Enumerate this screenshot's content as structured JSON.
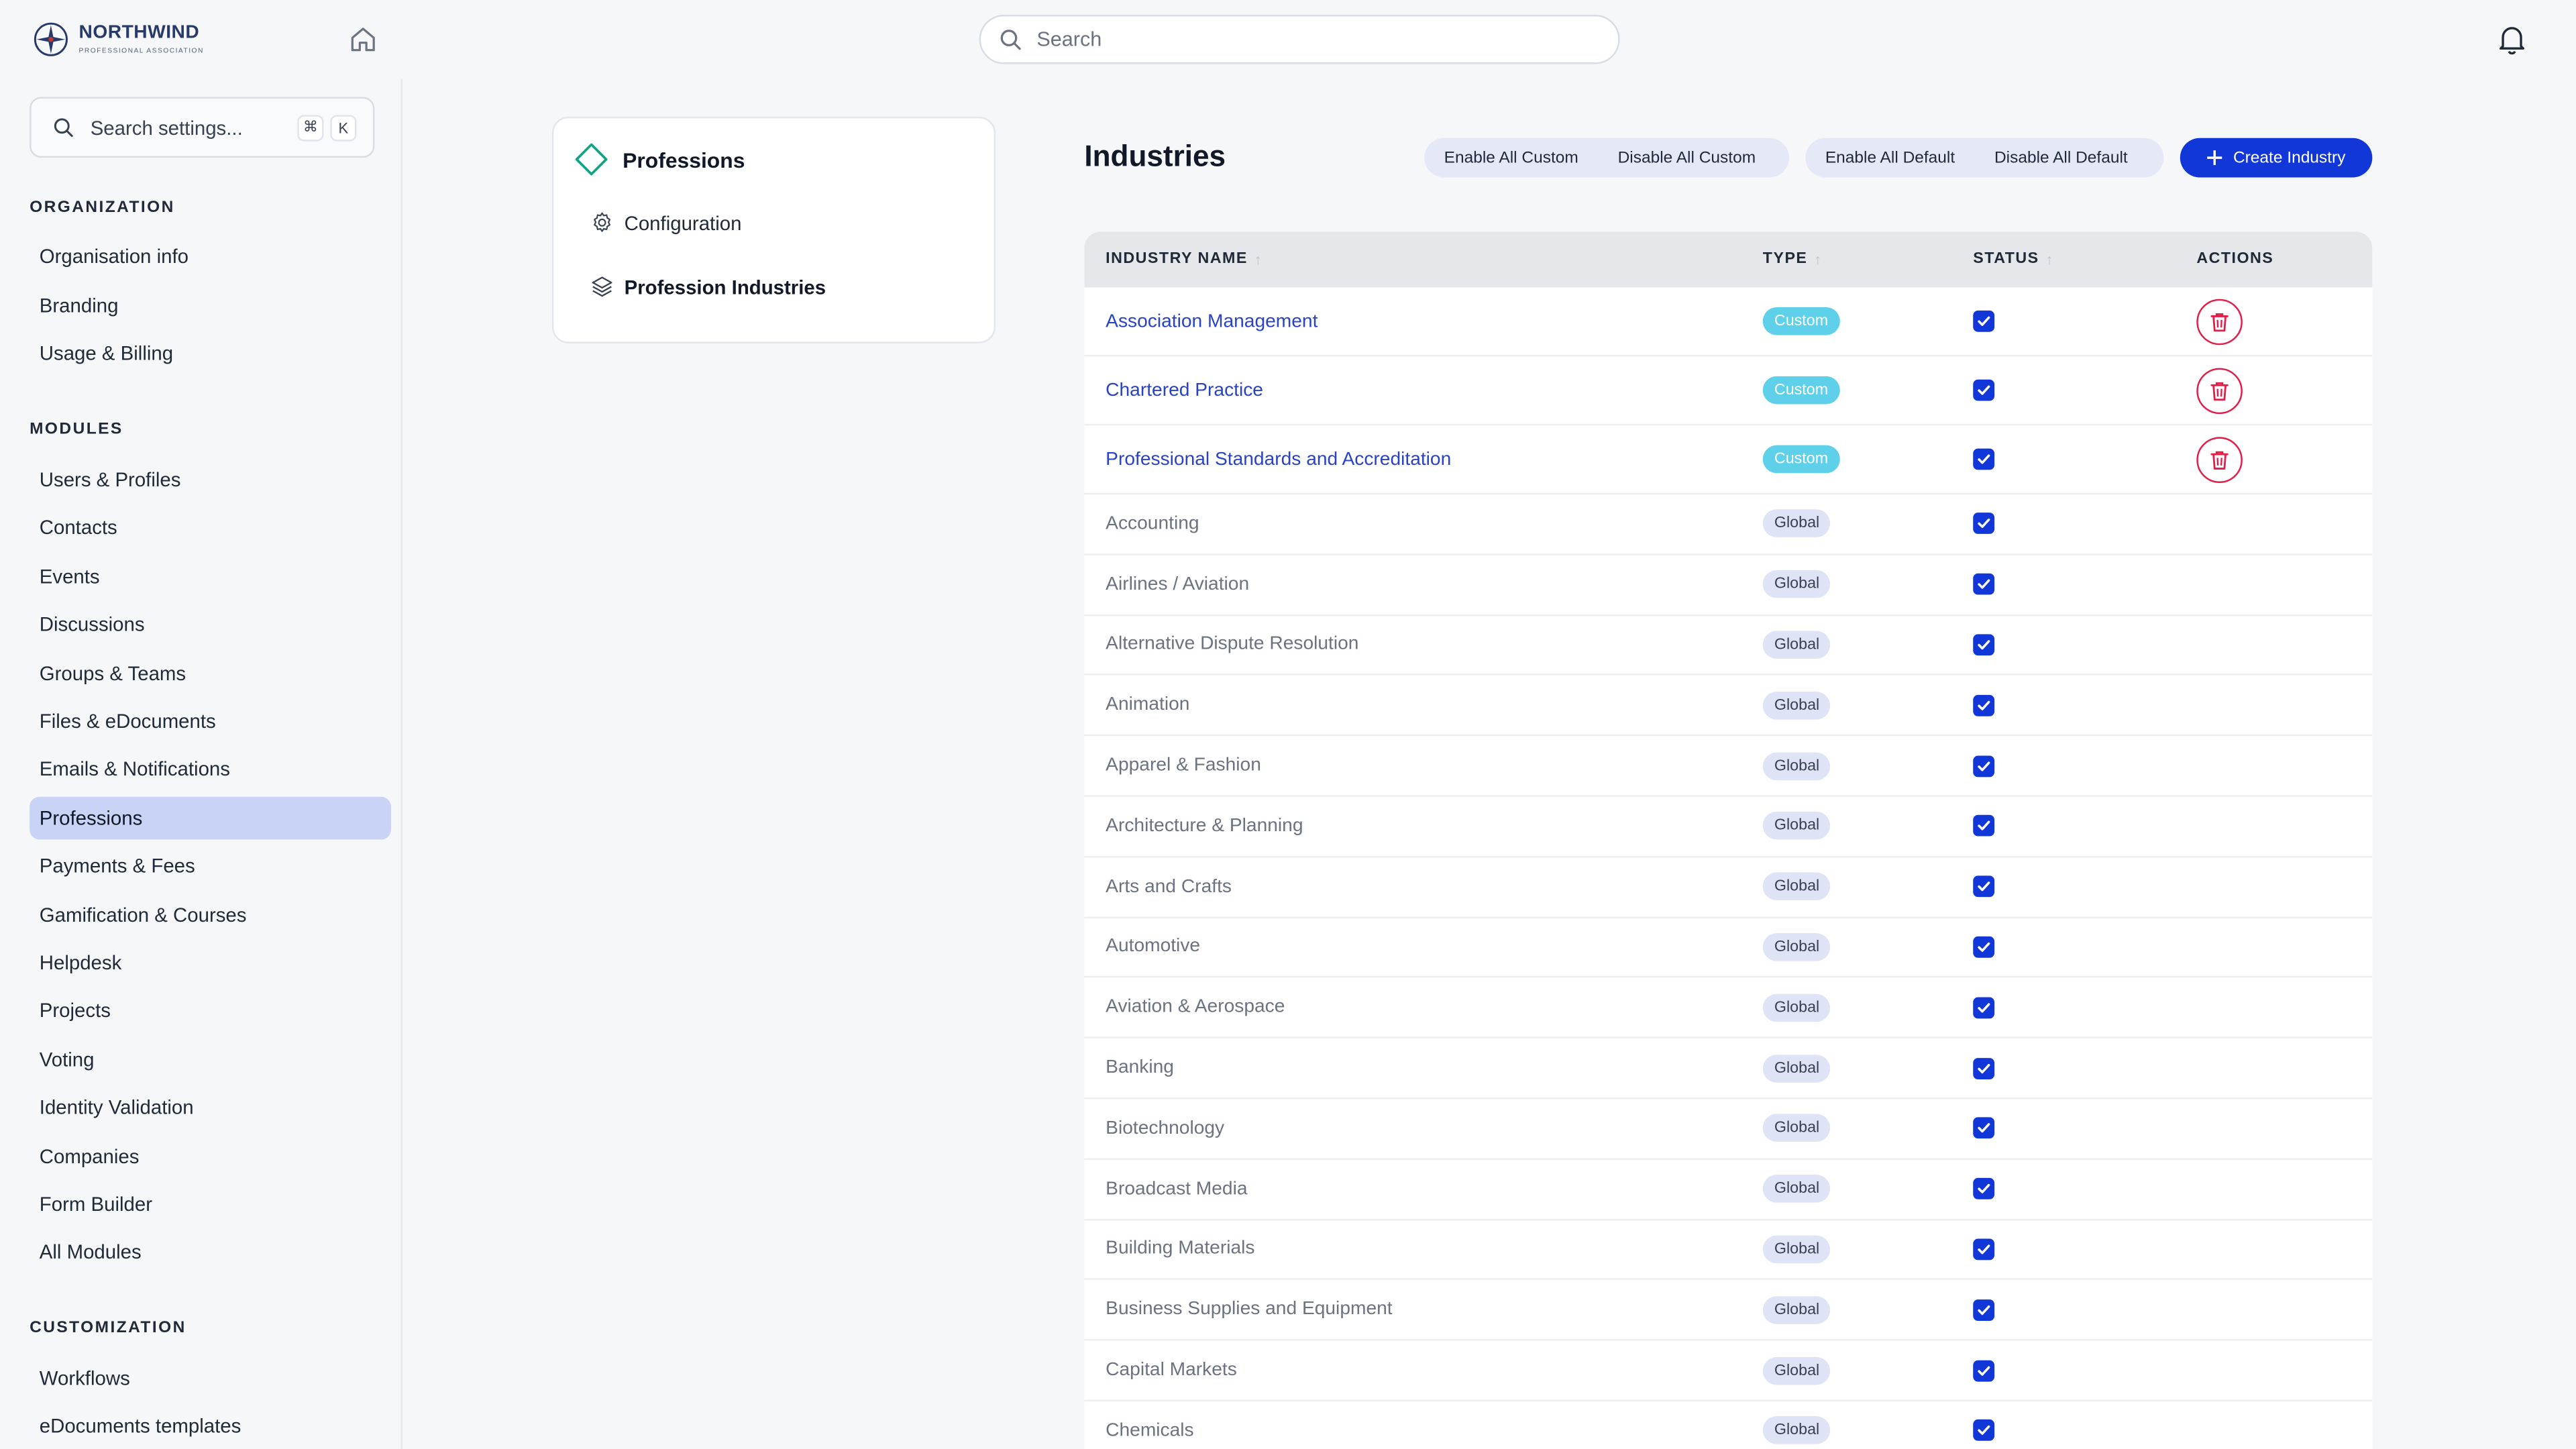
{
  "brand": {
    "name": "NORTHWIND",
    "subtitle": "PROFESSIONAL ASSOCIATION"
  },
  "topbar": {
    "search_placeholder": "Search"
  },
  "sidebar": {
    "search_placeholder": "Search settings...",
    "shortcut_keys": [
      "⌘",
      "K"
    ],
    "sections": [
      {
        "title": "ORGANIZATION",
        "items": [
          "Organisation info",
          "Branding",
          "Usage & Billing"
        ]
      },
      {
        "title": "MODULES",
        "items": [
          "Users & Profiles",
          "Contacts",
          "Events",
          "Discussions",
          "Groups & Teams",
          "Files & eDocuments",
          "Emails & Notifications",
          "Professions",
          "Payments & Fees",
          "Gamification & Courses",
          "Helpdesk",
          "Projects",
          "Voting",
          "Identity Validation",
          "Companies",
          "Form Builder",
          "All Modules"
        ]
      },
      {
        "title": "CUSTOMIZATION",
        "items": [
          "Workflows",
          "eDocuments templates"
        ]
      }
    ],
    "active_item": "Professions"
  },
  "subnav": {
    "title": "Professions",
    "items": [
      {
        "label": "Configuration",
        "icon": "gear-icon",
        "active": false
      },
      {
        "label": "Profession Industries",
        "icon": "layers-icon",
        "active": true
      }
    ]
  },
  "page": {
    "title": "Industries",
    "buttons": {
      "enable_all_custom": "Enable All Custom",
      "disable_all_custom": "Disable All Custom",
      "enable_all_default": "Enable All Default",
      "disable_all_default": "Disable All Default",
      "create": "Create Industry"
    }
  },
  "table": {
    "headers": {
      "name": "INDUSTRY NAME",
      "type": "TYPE",
      "status": "STATUS",
      "actions": "ACTIONS"
    },
    "rows": [
      {
        "name": "Association Management",
        "type": "Custom",
        "enabled": true
      },
      {
        "name": "Chartered Practice",
        "type": "Custom",
        "enabled": true
      },
      {
        "name": "Professional Standards and Accreditation",
        "type": "Custom",
        "enabled": true
      },
      {
        "name": "Accounting",
        "type": "Global",
        "enabled": true
      },
      {
        "name": "Airlines / Aviation",
        "type": "Global",
        "enabled": true
      },
      {
        "name": "Alternative Dispute Resolution",
        "type": "Global",
        "enabled": true
      },
      {
        "name": "Animation",
        "type": "Global",
        "enabled": true
      },
      {
        "name": "Apparel & Fashion",
        "type": "Global",
        "enabled": true
      },
      {
        "name": "Architecture & Planning",
        "type": "Global",
        "enabled": true
      },
      {
        "name": "Arts and Crafts",
        "type": "Global",
        "enabled": true
      },
      {
        "name": "Automotive",
        "type": "Global",
        "enabled": true
      },
      {
        "name": "Aviation & Aerospace",
        "type": "Global",
        "enabled": true
      },
      {
        "name": "Banking",
        "type": "Global",
        "enabled": true
      },
      {
        "name": "Biotechnology",
        "type": "Global",
        "enabled": true
      },
      {
        "name": "Broadcast Media",
        "type": "Global",
        "enabled": true
      },
      {
        "name": "Building Materials",
        "type": "Global",
        "enabled": true
      },
      {
        "name": "Business Supplies and Equipment",
        "type": "Global",
        "enabled": true
      },
      {
        "name": "Capital Markets",
        "type": "Global",
        "enabled": true
      },
      {
        "name": "Chemicals",
        "type": "Global",
        "enabled": true
      }
    ]
  },
  "colors": {
    "primary": "#1237d8",
    "custom_badge": "#5fd0ea",
    "global_badge": "#dfe3f6",
    "danger": "#e11d48",
    "active_nav": "#c9d3f5"
  }
}
